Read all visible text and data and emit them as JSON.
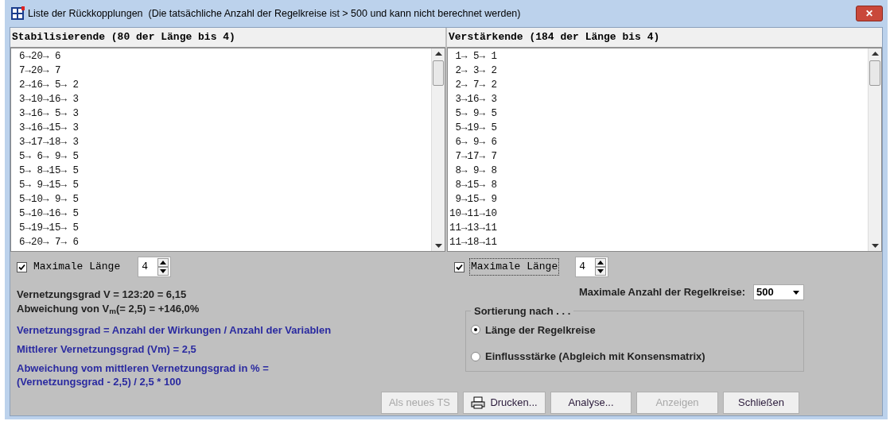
{
  "window": {
    "title": "Liste der Rückkopplungen  (Die tatsächliche Anzahl der Regelkreise ist > 500 und kann nicht berechnet werden)",
    "close_glyph": "✕"
  },
  "panels": [
    {
      "header": "Stabilisierende (80 der Länge bis 4)",
      "items": [
        "6→20→ 6",
        "7→20→ 7",
        "2→16→ 5→ 2",
        "3→10→16→ 3",
        "3→16→ 5→ 3",
        "3→16→15→ 3",
        "3→17→18→ 3",
        "5→ 6→ 9→ 5",
        "5→ 8→15→ 5",
        "5→ 9→15→ 5",
        "5→10→ 9→ 5",
        "5→10→16→ 5",
        "5→19→15→ 5",
        "6→20→ 7→ 6"
      ],
      "max_length": {
        "label": "Maximale Länge",
        "checked": true,
        "focused": false,
        "value": "4"
      }
    },
    {
      "header": "Verstärkende (184 der Länge bis 4)",
      "items": [
        " 1→ 5→ 1",
        " 2→ 3→ 2",
        " 2→ 7→ 2",
        " 3→16→ 3",
        " 5→ 9→ 5",
        " 5→19→ 5",
        " 6→ 9→ 6",
        " 7→17→ 7",
        " 8→ 9→ 8",
        " 8→15→ 8",
        " 9→15→ 9",
        "10→11→10",
        "11→13→11",
        "11→18→11"
      ],
      "max_length": {
        "label": "Maximale Länge",
        "checked": true,
        "focused": true,
        "value": "4"
      }
    }
  ],
  "stats": [
    "Vernetzungsgrad V = 123:20 = 6,15",
    "Abweichung von V$_{m}$(= 2,5) = +146,0%"
  ],
  "notes": [
    "Vernetzungsgrad = Anzahl der Wirkungen / Anzahl der Variablen",
    "Mittlerer Vernetzungsgrad (Vm) = 2,5",
    "Abweichung vom mittleren Vernetzungsgrad in % =\n(Vernetzungsgrad - 2,5) / 2,5 * 100"
  ],
  "max_loops": {
    "label": "Maximale Anzahl der Regelkreise:",
    "value": "500"
  },
  "sorting": {
    "legend": "Sortierung nach . . .",
    "options": [
      {
        "label": "Länge der Regelkreise",
        "selected": true
      },
      {
        "label": "Einflussstärke (Abgleich mit Konsensmatrix)",
        "selected": false
      }
    ]
  },
  "buttons": [
    {
      "label": "Als neues TS",
      "disabled": true,
      "icon": false
    },
    {
      "label": "Drucken...",
      "disabled": false,
      "icon": true
    },
    {
      "label": "Analyse...",
      "disabled": false,
      "icon": false
    },
    {
      "label": "Anzeigen",
      "disabled": true,
      "icon": false
    },
    {
      "label": "Schließen",
      "disabled": false,
      "icon": false
    }
  ]
}
